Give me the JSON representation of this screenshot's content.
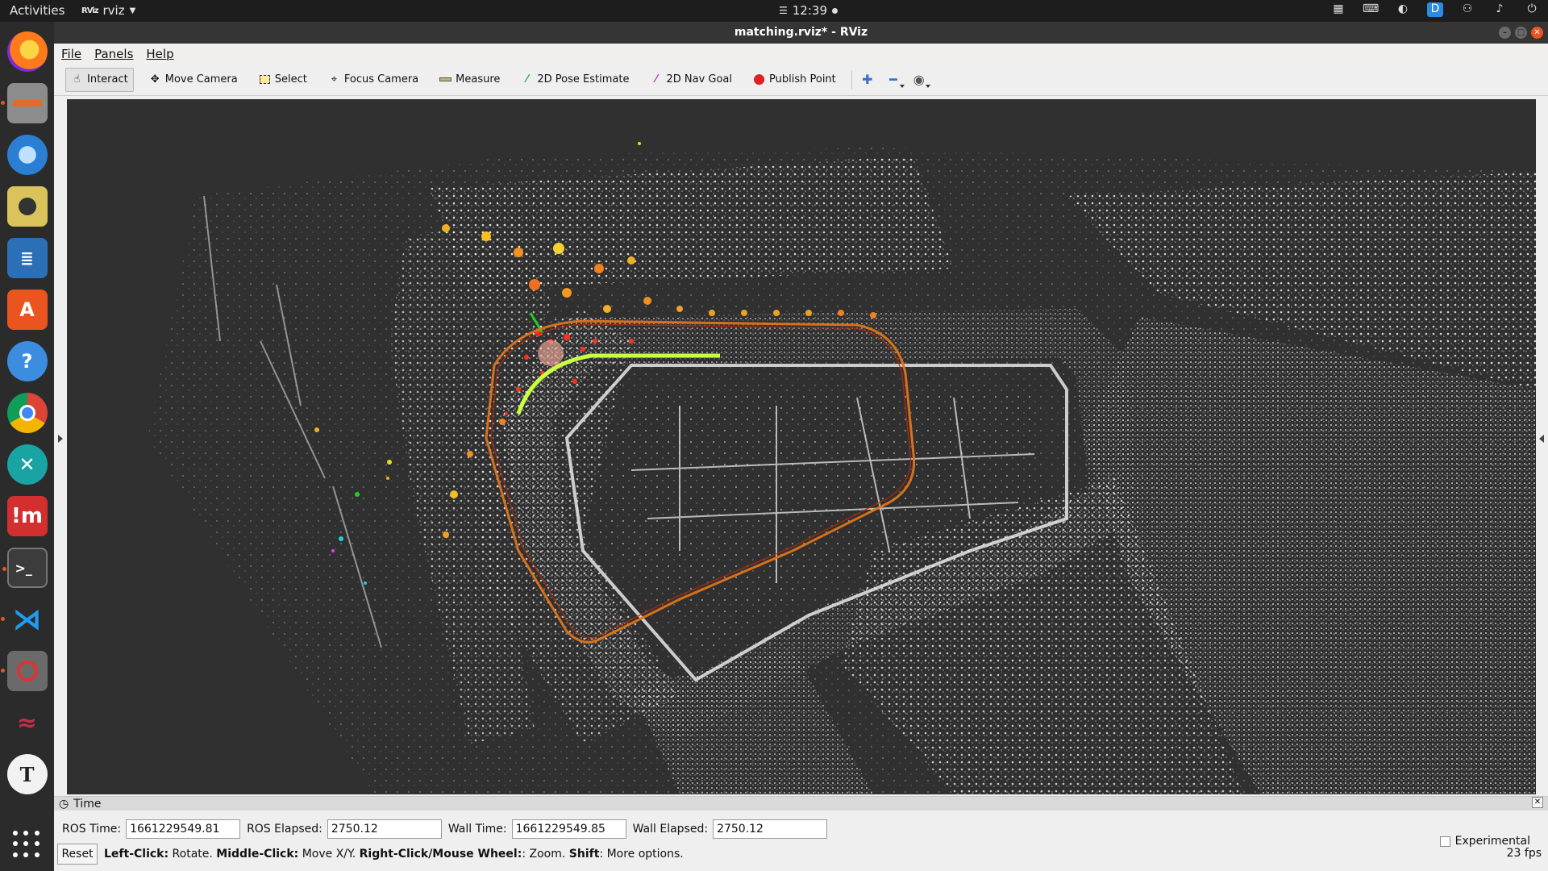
{
  "topbar": {
    "activities": "Activities",
    "app_name": "rviz",
    "app_logo": "RViz",
    "clock": "12:39"
  },
  "window": {
    "title": "matching.rviz* - RViz"
  },
  "menubar": {
    "items": [
      {
        "label": "File"
      },
      {
        "label": "Panels"
      },
      {
        "label": "Help"
      }
    ]
  },
  "toolbar": {
    "tools": [
      {
        "label": "Interact",
        "icon": "hand-icon",
        "active": true
      },
      {
        "label": "Move Camera",
        "icon": "move-camera-icon"
      },
      {
        "label": "Select",
        "icon": "select-icon"
      },
      {
        "label": "Focus Camera",
        "icon": "focus-icon"
      },
      {
        "label": "Measure",
        "icon": "ruler-icon"
      },
      {
        "label": "2D Pose Estimate",
        "icon": "pose-estimate-icon"
      },
      {
        "label": "2D Nav Goal",
        "icon": "nav-goal-icon"
      },
      {
        "label": "Publish Point",
        "icon": "pin-icon"
      }
    ],
    "extra_icons": [
      "plus-icon",
      "minus-icon",
      "eye-icon"
    ]
  },
  "dock": {
    "apps": [
      {
        "name": "firefox-icon",
        "color": "#e66000"
      },
      {
        "name": "files-icon",
        "color": "#8c8c8c"
      },
      {
        "name": "thunderbird-icon",
        "color": "#2a7fd4"
      },
      {
        "name": "rhythmbox-icon",
        "color": "#d9b44a"
      },
      {
        "name": "writer-icon",
        "color": "#2b6fb6"
      },
      {
        "name": "software-center-icon",
        "color": "#e9541f"
      },
      {
        "name": "help-icon",
        "color": "#3c8de0"
      },
      {
        "name": "chrome-icon",
        "color": "#3f8e3f"
      },
      {
        "name": "xmind-icon",
        "color": "#1aa3a3"
      },
      {
        "name": "imagej-icon",
        "color": "#d32f2f"
      },
      {
        "name": "terminal-icon",
        "color": "#3c3c3c"
      },
      {
        "name": "vscode-icon",
        "color": "#1f7ecb"
      },
      {
        "name": "blocker-icon",
        "color": "#6a6a6a"
      },
      {
        "name": "kali-icon",
        "color": "#c02f4a"
      },
      {
        "name": "typora-icon",
        "color": "#f2f2f2"
      }
    ],
    "app_grid": "show-applications-icon"
  },
  "time_panel": {
    "header": "Time",
    "ros_time_label": "ROS Time:",
    "ros_time_value": "1661229549.81",
    "ros_elapsed_label": "ROS Elapsed:",
    "ros_elapsed_value": "2750.12",
    "wall_time_label": "Wall Time:",
    "wall_time_value": "1661229549.85",
    "wall_elapsed_label": "Wall Elapsed:",
    "wall_elapsed_value": "2750.12",
    "experimental_label": "Experimental"
  },
  "status": {
    "reset_label": "Reset",
    "lc_label": "Left-Click:",
    "lc_text": "Rotate.",
    "mc_label": "Middle-Click:",
    "mc_text": "Move X/Y.",
    "rc_label": "Right-Click/Mouse Wheel:",
    "rc_text": ": Zoom.",
    "shift_label": "Shift",
    "shift_text": ": More options.",
    "fps": "23 fps"
  },
  "colors": {
    "viewport_bg": "#303030",
    "trajectory": "#e0741a",
    "accent": "#e9541f"
  }
}
